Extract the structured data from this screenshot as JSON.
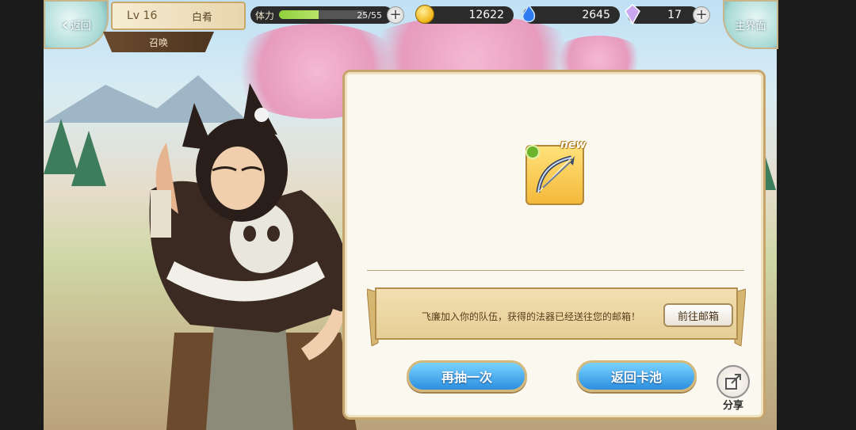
{
  "header": {
    "back_label": "返回",
    "player_level": "Lv 16",
    "player_name": "白肴",
    "mode_tab": "召唤",
    "home_label": "主界面"
  },
  "resources": {
    "stamina_label": "体力",
    "stamina_value": "25/55",
    "stamina_fraction": 0.4545,
    "gold": "12622",
    "spirit": "2645",
    "crystal": "17"
  },
  "result": {
    "new_badge": "new",
    "item_icon": "bow-weapon-icon",
    "element_icon": "wind-element-icon",
    "message": "飞廉加入你的队伍，获得的法器已经送往您的邮箱！",
    "mailbox_button": "前往邮箱",
    "draw_again_button": "再抽一次",
    "return_pool_button": "返回卡池",
    "share_label": "分享"
  },
  "colors": {
    "action_button": "#2c8fe0",
    "panel_border": "#c7a46a",
    "stamina_fill": "#8fcf3c"
  }
}
